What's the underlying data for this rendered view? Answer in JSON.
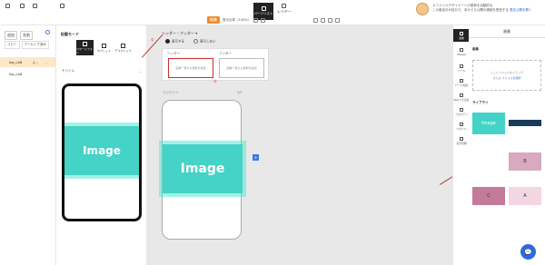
{
  "topbar": {
    "left_items": [
      "",
      "",
      "",
      ""
    ],
    "center_dark": "パーツリスト",
    "center_right": "レイヤー",
    "pill": "編集",
    "zoom": "表示比率（100%）",
    "notice_text": "スファイルデザイナーへの更新を自動的な",
    "notice_text2": "この度自分が自分で、本からら公開の連続を受信する",
    "notice_link": "限定公開を開く"
  },
  "leftrail": {
    "tabs": [
      "追加",
      "名前"
    ],
    "sub_tabs": [
      "コピー",
      "アーカイブ済み"
    ],
    "pages": [
      {
        "name": "top_LAB",
        "ctrl1": "名 ◇",
        "ctrl2": "⋯",
        "active": true
      },
      {
        "name": "top_LAB",
        "ctrl1": "",
        "ctrl2": "",
        "active": false
      }
    ]
  },
  "template_col": {
    "title": "記載モード",
    "buttons": [
      {
        "label": "スマートフォン",
        "dark": true
      },
      {
        "label": "タブレット",
        "dark": false
      },
      {
        "label": "デスクトップ",
        "dark": false
      }
    ],
    "section": "モバイル",
    "image_text": "Image"
  },
  "canvas": {
    "title": "ヘッダー・フッター ▾",
    "radio_on": "表示する",
    "radio_off": "表示しない",
    "header_label": "ヘッダー",
    "footer_label": "フッター",
    "header_box": "画像一覧から選択を追加",
    "footer_box": "画像一覧から選択を追加",
    "page_label": "コンテンツ",
    "page_label2": "1/1",
    "image_text": "Image",
    "badge": "+",
    "marker1": "①",
    "marker2": "②",
    "marker3": "③"
  },
  "rightrail": {
    "items": [
      "画像",
      "Widget",
      "ツール",
      "パーツ追加",
      "Webフォ追加",
      "プロパティ",
      "スタイル",
      "表示管理"
    ]
  },
  "rightpanel": {
    "tab": "画像",
    "section1": "画像",
    "drop_line1": "ここにファイルをドラッグ",
    "drop_line2": "または",
    "drop_link": "ファイルを選択",
    "section2": "ライブラリ",
    "lib_items": [
      "Image",
      "",
      "B",
      "B",
      "C",
      "A"
    ]
  },
  "colors": {
    "accent": "#f08c2a",
    "teal": "#44d3c6",
    "red": "#d12a2a",
    "blue": "#2d6cdf"
  }
}
